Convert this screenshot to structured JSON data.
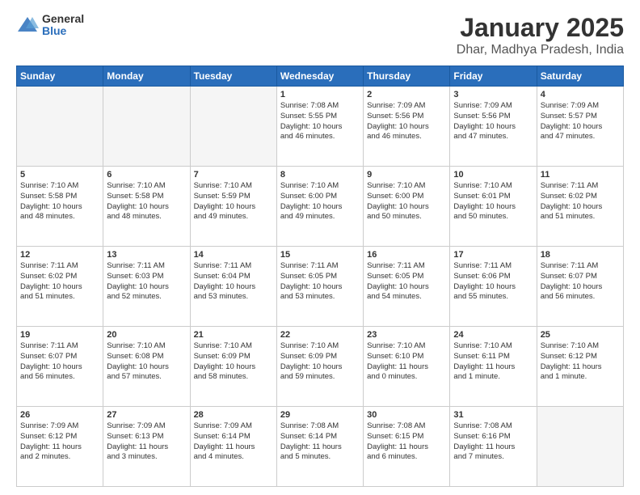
{
  "logo": {
    "general": "General",
    "blue": "Blue"
  },
  "header": {
    "title": "January 2025",
    "subtitle": "Dhar, Madhya Pradesh, India"
  },
  "days_of_week": [
    "Sunday",
    "Monday",
    "Tuesday",
    "Wednesday",
    "Thursday",
    "Friday",
    "Saturday"
  ],
  "weeks": [
    [
      {
        "day": "",
        "info": ""
      },
      {
        "day": "",
        "info": ""
      },
      {
        "day": "",
        "info": ""
      },
      {
        "day": "1",
        "info": "Sunrise: 7:08 AM\nSunset: 5:55 PM\nDaylight: 10 hours\nand 46 minutes."
      },
      {
        "day": "2",
        "info": "Sunrise: 7:09 AM\nSunset: 5:56 PM\nDaylight: 10 hours\nand 46 minutes."
      },
      {
        "day": "3",
        "info": "Sunrise: 7:09 AM\nSunset: 5:56 PM\nDaylight: 10 hours\nand 47 minutes."
      },
      {
        "day": "4",
        "info": "Sunrise: 7:09 AM\nSunset: 5:57 PM\nDaylight: 10 hours\nand 47 minutes."
      }
    ],
    [
      {
        "day": "5",
        "info": "Sunrise: 7:10 AM\nSunset: 5:58 PM\nDaylight: 10 hours\nand 48 minutes."
      },
      {
        "day": "6",
        "info": "Sunrise: 7:10 AM\nSunset: 5:58 PM\nDaylight: 10 hours\nand 48 minutes."
      },
      {
        "day": "7",
        "info": "Sunrise: 7:10 AM\nSunset: 5:59 PM\nDaylight: 10 hours\nand 49 minutes."
      },
      {
        "day": "8",
        "info": "Sunrise: 7:10 AM\nSunset: 6:00 PM\nDaylight: 10 hours\nand 49 minutes."
      },
      {
        "day": "9",
        "info": "Sunrise: 7:10 AM\nSunset: 6:00 PM\nDaylight: 10 hours\nand 50 minutes."
      },
      {
        "day": "10",
        "info": "Sunrise: 7:10 AM\nSunset: 6:01 PM\nDaylight: 10 hours\nand 50 minutes."
      },
      {
        "day": "11",
        "info": "Sunrise: 7:11 AM\nSunset: 6:02 PM\nDaylight: 10 hours\nand 51 minutes."
      }
    ],
    [
      {
        "day": "12",
        "info": "Sunrise: 7:11 AM\nSunset: 6:02 PM\nDaylight: 10 hours\nand 51 minutes."
      },
      {
        "day": "13",
        "info": "Sunrise: 7:11 AM\nSunset: 6:03 PM\nDaylight: 10 hours\nand 52 minutes."
      },
      {
        "day": "14",
        "info": "Sunrise: 7:11 AM\nSunset: 6:04 PM\nDaylight: 10 hours\nand 53 minutes."
      },
      {
        "day": "15",
        "info": "Sunrise: 7:11 AM\nSunset: 6:05 PM\nDaylight: 10 hours\nand 53 minutes."
      },
      {
        "day": "16",
        "info": "Sunrise: 7:11 AM\nSunset: 6:05 PM\nDaylight: 10 hours\nand 54 minutes."
      },
      {
        "day": "17",
        "info": "Sunrise: 7:11 AM\nSunset: 6:06 PM\nDaylight: 10 hours\nand 55 minutes."
      },
      {
        "day": "18",
        "info": "Sunrise: 7:11 AM\nSunset: 6:07 PM\nDaylight: 10 hours\nand 56 minutes."
      }
    ],
    [
      {
        "day": "19",
        "info": "Sunrise: 7:11 AM\nSunset: 6:07 PM\nDaylight: 10 hours\nand 56 minutes."
      },
      {
        "day": "20",
        "info": "Sunrise: 7:10 AM\nSunset: 6:08 PM\nDaylight: 10 hours\nand 57 minutes."
      },
      {
        "day": "21",
        "info": "Sunrise: 7:10 AM\nSunset: 6:09 PM\nDaylight: 10 hours\nand 58 minutes."
      },
      {
        "day": "22",
        "info": "Sunrise: 7:10 AM\nSunset: 6:09 PM\nDaylight: 10 hours\nand 59 minutes."
      },
      {
        "day": "23",
        "info": "Sunrise: 7:10 AM\nSunset: 6:10 PM\nDaylight: 11 hours\nand 0 minutes."
      },
      {
        "day": "24",
        "info": "Sunrise: 7:10 AM\nSunset: 6:11 PM\nDaylight: 11 hours\nand 1 minute."
      },
      {
        "day": "25",
        "info": "Sunrise: 7:10 AM\nSunset: 6:12 PM\nDaylight: 11 hours\nand 1 minute."
      }
    ],
    [
      {
        "day": "26",
        "info": "Sunrise: 7:09 AM\nSunset: 6:12 PM\nDaylight: 11 hours\nand 2 minutes."
      },
      {
        "day": "27",
        "info": "Sunrise: 7:09 AM\nSunset: 6:13 PM\nDaylight: 11 hours\nand 3 minutes."
      },
      {
        "day": "28",
        "info": "Sunrise: 7:09 AM\nSunset: 6:14 PM\nDaylight: 11 hours\nand 4 minutes."
      },
      {
        "day": "29",
        "info": "Sunrise: 7:08 AM\nSunset: 6:14 PM\nDaylight: 11 hours\nand 5 minutes."
      },
      {
        "day": "30",
        "info": "Sunrise: 7:08 AM\nSunset: 6:15 PM\nDaylight: 11 hours\nand 6 minutes."
      },
      {
        "day": "31",
        "info": "Sunrise: 7:08 AM\nSunset: 6:16 PM\nDaylight: 11 hours\nand 7 minutes."
      },
      {
        "day": "",
        "info": ""
      }
    ]
  ]
}
